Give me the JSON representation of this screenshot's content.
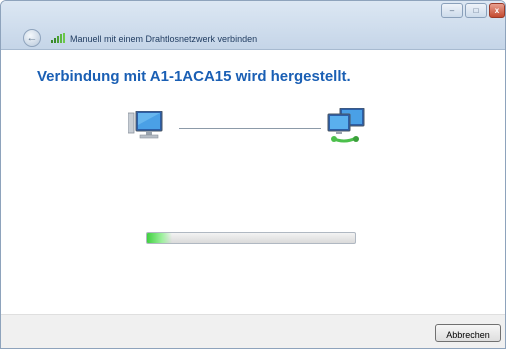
{
  "window": {
    "title": "Manuell mit einem Drahtlosnetzwerk verbinden",
    "controls": {
      "minimize": "–",
      "maximize": "□",
      "close": "x"
    }
  },
  "main": {
    "heading": "Verbindung mit A1-1ACA15 wird hergestellt.",
    "progress_fraction": 0.12
  },
  "footer": {
    "cancel_label": "Abbrechen"
  },
  "icons": {
    "back": "back-arrow-icon",
    "wifi": "wifi-signal-icon",
    "computer": "computer-icon",
    "network": "network-icon"
  },
  "colors": {
    "heading": "#1a5fb4",
    "progress": "#40d040",
    "titlebar": "#c5d5e8"
  }
}
